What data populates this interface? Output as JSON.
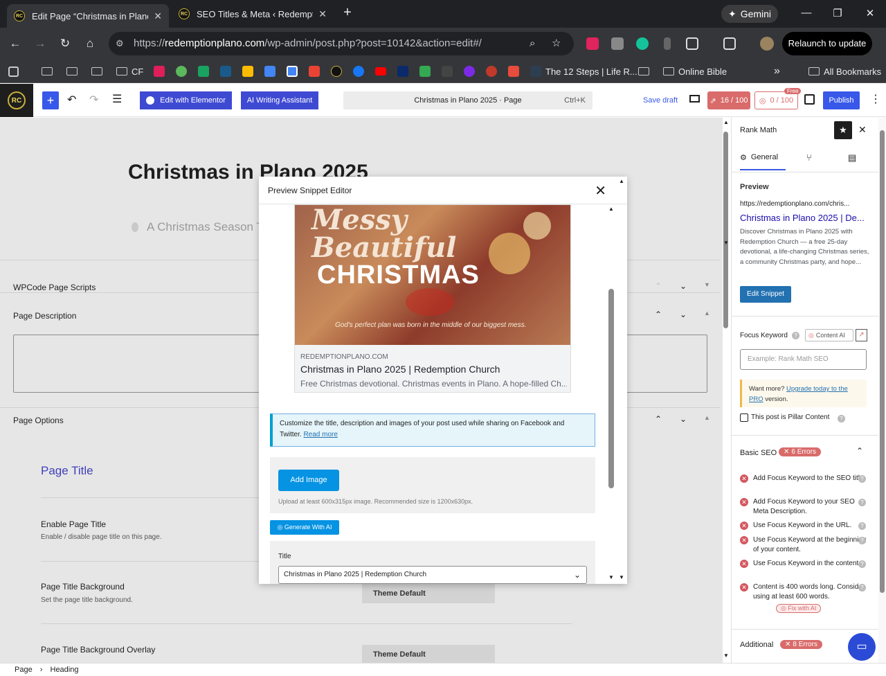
{
  "browser": {
    "tabs": [
      {
        "title": "Edit Page “Christmas in Plano 2025”",
        "active": true
      },
      {
        "title": "SEO Titles & Meta ‹ Redemption",
        "active": false
      }
    ],
    "gemini_label": "Gemini",
    "url_prefix": "https://",
    "url_host": "redemptionplano.com",
    "url_path": "/wp-admin/post.php?post=10142&action=edit#/",
    "relaunch_label": "Relaunch to update",
    "bookmarks": {
      "cf": "CF",
      "steps": "The 12 Steps | Life R...",
      "online_bible": "Online Bible",
      "all": "All Bookmarks"
    }
  },
  "wp_toolbar": {
    "logo_text": "RC",
    "elementor_label": "Edit with Elementor",
    "ai_label": "AI Writing Assistant",
    "command_label": "Christmas in Plano 2025 · Page",
    "command_kbd": "Ctrl+K",
    "save_draft": "Save draft",
    "seo_score": "16 / 100",
    "content_ai_score": "0 / 100",
    "free_badge": "Free",
    "publish": "Publish"
  },
  "content": {
    "page_title": "Christmas in Plano 2025",
    "subheading": "A Christmas Season T",
    "wpcode_title": "WPCode Page Scripts",
    "description_title": "Page Description",
    "options_title": "Page Options",
    "page_title_section": "Page Title",
    "enable_title_label": "Enable Page Title",
    "enable_title_desc": "Enable / disable page title on this page.",
    "title_bg_label": "Page Title Background",
    "title_bg_desc": "Set the page title background.",
    "title_bg_value": "Theme Default",
    "overlay_label": "Page Title Background Overlay",
    "overlay_value": "Theme Default"
  },
  "breadcrumb": {
    "root": "Page",
    "current": "Heading"
  },
  "sidebar": {
    "title": "Rank Math",
    "tab_general": "General",
    "preview_heading": "Preview",
    "preview_url": "https://redemptionplano.com/chris...",
    "preview_title": "Christmas in Plano 2025 | De...",
    "preview_desc": "Discover Christmas in Plano 2025 with Redemption Church — a free 25-day devotional, a life-changing Christmas series, a community Christmas party, and hope...",
    "edit_snippet": "Edit Snippet",
    "focus_keyword_label": "Focus Keyword",
    "content_ai_label": "Content AI",
    "focus_placeholder": "Example: Rank Math SEO",
    "upgrade_text_1": "Want more? ",
    "upgrade_link": "Upgrade today to the PRO",
    "upgrade_text_2": " version.",
    "pillar_label": "This post is Pillar Content",
    "basic_seo_label": "Basic SEO",
    "basic_seo_errors": "6 Errors",
    "errors": [
      "Add Focus Keyword to the SEO title.",
      "Add Focus Keyword to your SEO Meta Description.",
      "Use Focus Keyword in the URL.",
      "Use Focus Keyword at the beginning of your content.",
      "Use Focus Keyword in the content.",
      "Content is 400 words long. Consider using at least 600 words."
    ],
    "fix_ai": "Fix with AI",
    "additional_label": "Additional",
    "additional_errors": "8 Errors"
  },
  "modal": {
    "title": "Preview Snippet Editor",
    "image_line1": "Messy",
    "image_line2": "Beautiful",
    "image_line3": "CHRISTMAS",
    "image_tagline": "God's perfect plan was born in the middle of our biggest mess.",
    "fb_domain": "REDEMPTIONPLANO.COM",
    "fb_title": "Christmas in Plano 2025 | Redemption Church",
    "fb_desc": "Free Christmas devotional. Christmas events in Plano. A hope-filled Ch...",
    "notice_text": "Customize the title, description and images of your post used while sharing on Facebook and Twitter. ",
    "notice_link": "Read more",
    "add_image": "Add Image",
    "image_hint": "Upload at least 600x315px image. Recommended size is 1200x630px.",
    "generate_ai": "Generate With AI",
    "title_label": "Title",
    "title_value": "Christmas in Plano 2025 | Redemption Church"
  },
  "colors": {
    "wp_blue": "#3858e9",
    "rankmath_red": "#d96b6b",
    "elementor": "#3f4ad3",
    "fb_blue": "#0693e3"
  }
}
